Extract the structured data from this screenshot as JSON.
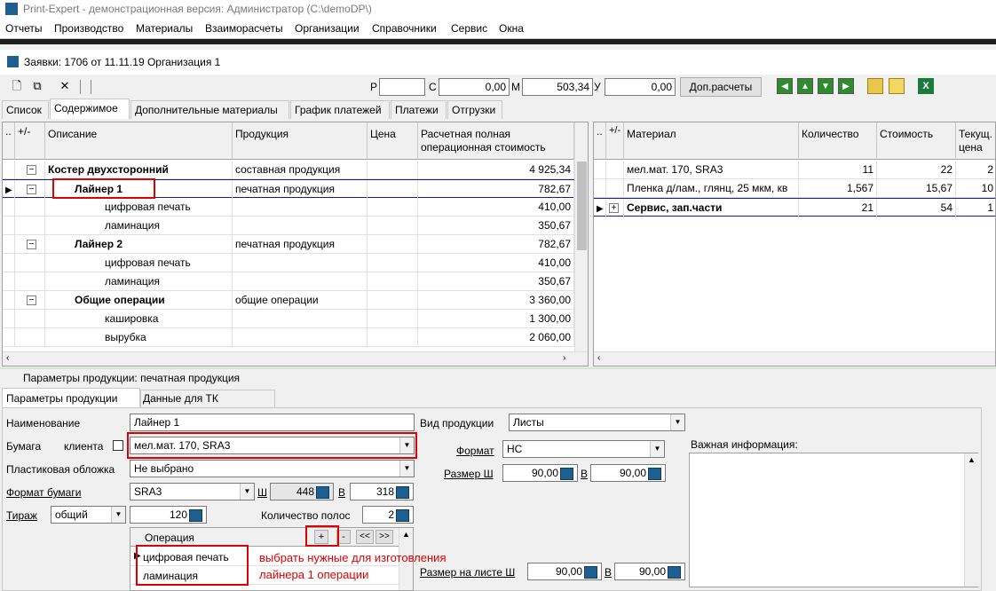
{
  "window": {
    "title": "Print-Expert - демонстрационная версия: Администратор (C:\\demoDP\\)"
  },
  "menu": [
    "Отчеты",
    "Производство",
    "Материалы",
    "Взаиморасчеты",
    "Организации",
    "Справочники",
    "Сервис",
    "Окна"
  ],
  "document": {
    "title": "Заявки: 1706 от 11.11.19  Организация 1"
  },
  "toolbar": {
    "p_label": "Р",
    "p_value": "",
    "c_label": "С",
    "c_value": "0,00",
    "m_label": "М",
    "m_value": "503,34",
    "u_label": "У",
    "u_value": "0,00",
    "dop_label": "Доп.расчеты"
  },
  "tabs": [
    "Список",
    "Содержимое",
    "Дополнительные материалы",
    "График платежей",
    "Платежи",
    "Отгрузки"
  ],
  "left_grid": {
    "headers": {
      "pm": "+/-",
      "desc": "Описание",
      "prod": "Продукция",
      "price": "Цена",
      "cost": "Расчетная полная операционная стоимость"
    },
    "rows": [
      {
        "pm": "⊟",
        "desc": "Костер двухсторонний",
        "prod": "составная продукция",
        "cost": "4 925,34",
        "bold": true,
        "indent": 0
      },
      {
        "pm": "⊟",
        "desc": "Лайнер 1",
        "prod": "печатная продукция",
        "cost": "782,67",
        "bold": true,
        "indent": 1,
        "current": true
      },
      {
        "pm": "",
        "desc": "цифровая печать",
        "prod": "",
        "cost": "410,00",
        "bold": false,
        "indent": 2
      },
      {
        "pm": "",
        "desc": "ламинация",
        "prod": "",
        "cost": "350,67",
        "bold": false,
        "indent": 2
      },
      {
        "pm": "⊟",
        "desc": "Лайнер 2",
        "prod": "печатная продукция",
        "cost": "782,67",
        "bold": true,
        "indent": 1
      },
      {
        "pm": "",
        "desc": "цифровая печать",
        "prod": "",
        "cost": "410,00",
        "bold": false,
        "indent": 2
      },
      {
        "pm": "",
        "desc": "ламинация",
        "prod": "",
        "cost": "350,67",
        "bold": false,
        "indent": 2
      },
      {
        "pm": "⊟",
        "desc": "Общие операции",
        "prod": "общие операции",
        "cost": "3 360,00",
        "bold": true,
        "indent": 1
      },
      {
        "pm": "",
        "desc": "кашировка",
        "prod": "",
        "cost": "1 300,00",
        "bold": false,
        "indent": 2
      },
      {
        "pm": "",
        "desc": "вырубка",
        "prod": "",
        "cost": "2 060,00",
        "bold": false,
        "indent": 2
      }
    ]
  },
  "right_grid": {
    "headers": {
      "pm": "+/-",
      "material": "Материал",
      "qty": "Количество",
      "cost": "Стоимость",
      "cur": "Текущ. цена"
    },
    "rows": [
      {
        "pm": "",
        "material": "мел.мат. 170, SRA3",
        "qty": "11",
        "cost": "22",
        "cur": "2",
        "bold": false
      },
      {
        "pm": "",
        "material": "Пленка д/лам., глянц, 25 мкм, кв",
        "qty": "1,567",
        "cost": "15,67",
        "cur": "10",
        "bold": false
      },
      {
        "pm": "⊞",
        "material": "Сервис, зап.части",
        "qty": "21",
        "cost": "54",
        "cur": "1",
        "bold": true,
        "current": true
      }
    ]
  },
  "params": {
    "header": "Параметры продукции: печатная продукция",
    "tabs": [
      "Параметры продукции",
      "Данные для ТК"
    ],
    "name_label": "Наименование",
    "name_value": "Лайнер 1",
    "paper_label": "Бумага",
    "client_label": "клиента",
    "paper_value": "мел.мат. 170, SRA3",
    "cover_label": "Пластиковая обложка",
    "cover_value": "Не выбрано",
    "format_label": "Формат бумаги",
    "format_value": "SRA3",
    "w_label": "Ш",
    "w_value": "448",
    "h_label": "В",
    "h_value": "318",
    "tirazh_label": "Тираж",
    "tirazh_type": "общий",
    "tirazh_value": "120",
    "polos_label": "Количество полос",
    "polos_value": "2",
    "op_header": "Операция",
    "op_plus": "+",
    "op_minus": "-",
    "op_prev": "<<",
    "op_next": ">>",
    "operations": [
      "цифровая печать",
      "ламинация"
    ],
    "vid_label": "Вид продукции",
    "vid_value": "Листы",
    "fmt_label": "Формат",
    "fmt_value": "НС",
    "size_label": "Размер Ш",
    "size_w": "90,00",
    "size_b_label": "В",
    "size_h": "90,00",
    "sheet_label": "Размер на листе Ш",
    "sheet_w": "90,00",
    "sheet_b_label": "В",
    "sheet_h": "90,00",
    "info_label": "Важная информация:"
  },
  "annotation": {
    "line1": "выбрать нужные для изготовления",
    "line2": "лайнера 1 операции"
  }
}
